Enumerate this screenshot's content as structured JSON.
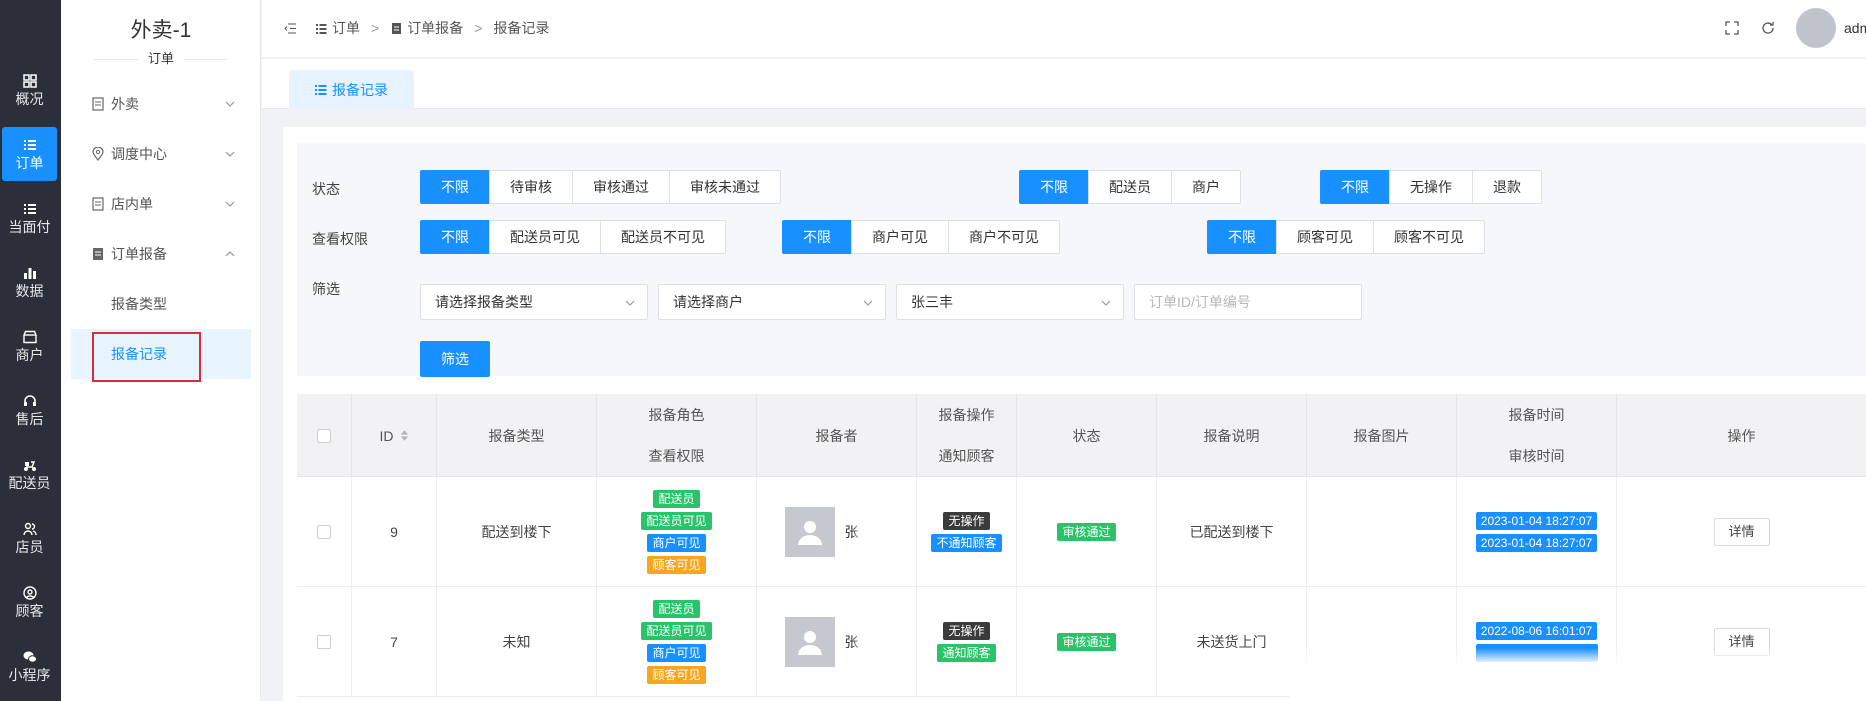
{
  "rail": [
    {
      "label": "概况",
      "icon": "dashboard-icon"
    },
    {
      "label": "订单",
      "icon": "list-icon",
      "active": true
    },
    {
      "label": "当面付",
      "icon": "list-icon"
    },
    {
      "label": "数据",
      "icon": "bar-chart-icon"
    },
    {
      "label": "商户",
      "icon": "shop-icon"
    },
    {
      "label": "售后",
      "icon": "headset-icon"
    },
    {
      "label": "配送员",
      "icon": "scooter-icon"
    },
    {
      "label": "店员",
      "icon": "users-icon"
    },
    {
      "label": "顾客",
      "icon": "user-circle-icon"
    },
    {
      "label": "小程序",
      "icon": "wechat-icon"
    }
  ],
  "sidebar": {
    "title": "外卖-1",
    "caption": "订单",
    "items": [
      {
        "label": "外卖",
        "icon": "document-icon"
      },
      {
        "label": "调度中心",
        "icon": "location-icon"
      },
      {
        "label": "店内单",
        "icon": "document-icon"
      },
      {
        "label": "订单报备",
        "icon": "clipboard-icon"
      },
      {
        "label": "报备类型"
      },
      {
        "label": "报备记录"
      }
    ]
  },
  "breadcrumb": {
    "items": [
      "订单",
      "订单报备",
      "报备记录"
    ]
  },
  "user": {
    "name": "admin"
  },
  "tab": {
    "label": "报备记录"
  },
  "filters": {
    "status": {
      "label": "状态",
      "options": [
        "不限",
        "待审核",
        "审核通过",
        "审核未通过"
      ]
    },
    "role": {
      "options": [
        "不限",
        "配送员",
        "商户"
      ]
    },
    "action": {
      "options": [
        "不限",
        "无操作",
        "退款"
      ]
    },
    "perm": {
      "label": "查看权限",
      "options": [
        "不限",
        "配送员可见",
        "配送员不可见"
      ]
    },
    "merchant_perm": {
      "options": [
        "不限",
        "商户可见",
        "商户不可见"
      ]
    },
    "customer_perm": {
      "options": [
        "不限",
        "顾客可见",
        "顾客不可见"
      ]
    },
    "screen": {
      "label": "筛选"
    },
    "type_select": {
      "placeholder": "请选择报备类型"
    },
    "merchant_select": {
      "placeholder": "请选择商户"
    },
    "rider_select": {
      "value": "张三丰"
    },
    "order_input": {
      "placeholder": "订单ID/订单编号"
    },
    "submit": "筛选"
  },
  "table": {
    "headers": {
      "id": "ID",
      "type": "报备类型",
      "role": "报备角色",
      "perm": "查看权限",
      "reporter": "报备者",
      "action": "报备操作",
      "notify": "通知顾客",
      "status": "状态",
      "desc": "报备说明",
      "image": "报备图片",
      "time": "报备时间",
      "audit_time": "审核时间",
      "op": "操作"
    },
    "rows": [
      {
        "id": "9",
        "type": "配送到楼下",
        "role": "配送员",
        "rider_vis": "配送员可见",
        "merchant_vis": "商户可见",
        "customer_vis": "顾客可见",
        "reporter": "张",
        "action": "无操作",
        "notify": "不通知顾客",
        "status": "审核通过",
        "desc": "已配送到楼下",
        "time": "2023-01-04 18:27:07",
        "audit_time": "2023-01-04 18:27:07",
        "op": "详情"
      },
      {
        "id": "7",
        "type": "未知",
        "role": "配送员",
        "rider_vis": "配送员可见",
        "merchant_vis": "商户可见",
        "customer_vis": "顾客可见",
        "reporter": "张",
        "action": "无操作",
        "notify": "通知顾客",
        "status": "审核通过",
        "desc": "未送货上门",
        "time": "2022-08-06 16:01:07",
        "audit_time": "",
        "op": "详情"
      }
    ]
  },
  "colors": {
    "primary": "#1890ff",
    "rail": "#2b2f3a",
    "success": "#2ac36a",
    "warning": "#f5a623",
    "highlight": "#e0293a"
  }
}
